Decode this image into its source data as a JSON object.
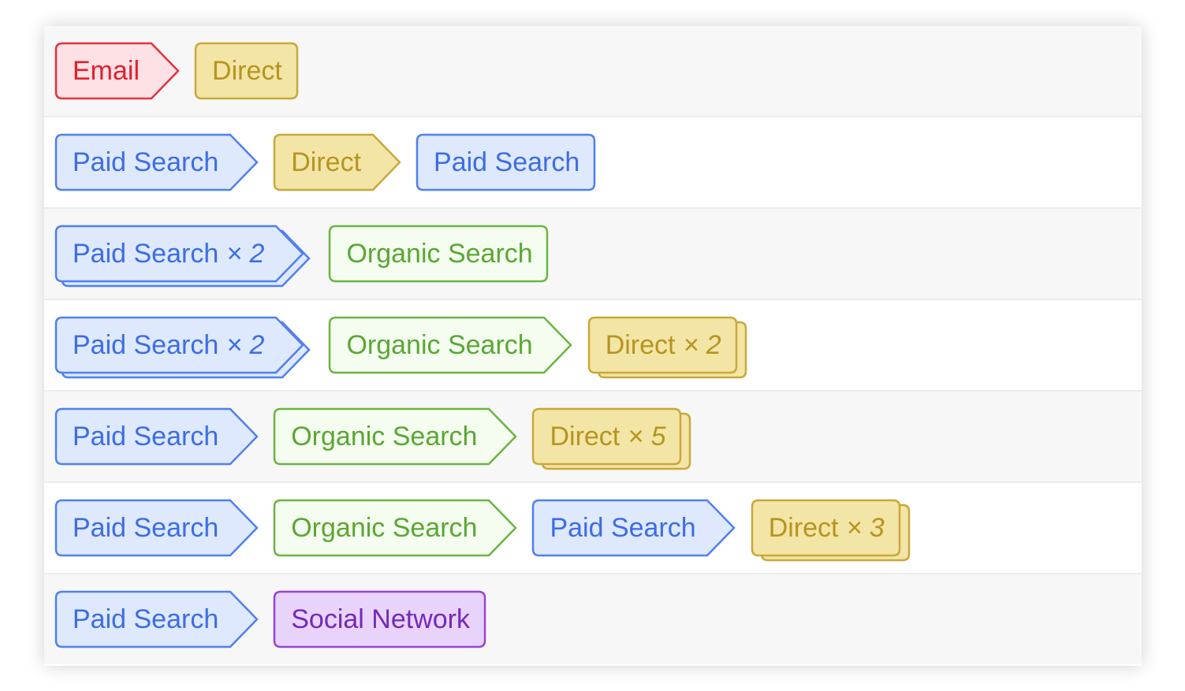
{
  "channels": {
    "email": {
      "stroke": "#e4323d",
      "fill": "#fde1e4",
      "text": "#e1202e"
    },
    "direct": {
      "stroke": "#c9a83a",
      "fill": "#f3e5a5",
      "text": "#b5951f"
    },
    "paid": {
      "stroke": "#4f80f0",
      "fill": "#dfe9fd",
      "text": "#3c6de6"
    },
    "organic": {
      "stroke": "#6bb442",
      "fill": "#f4fdef",
      "text": "#5aa733"
    },
    "social": {
      "stroke": "#9b42d6",
      "fill": "#e8d4fb",
      "text": "#7428bc"
    }
  },
  "rows": [
    {
      "steps": [
        {
          "label": "Email",
          "channel": "email"
        },
        {
          "label": "Direct",
          "channel": "direct"
        }
      ]
    },
    {
      "steps": [
        {
          "label": "Paid Search",
          "channel": "paid"
        },
        {
          "label": "Direct",
          "channel": "direct"
        },
        {
          "label": "Paid Search",
          "channel": "paid"
        }
      ]
    },
    {
      "steps": [
        {
          "label": "Paid Search",
          "channel": "paid",
          "count": "× 2"
        },
        {
          "label": "Organic Search",
          "channel": "organic"
        }
      ]
    },
    {
      "steps": [
        {
          "label": "Paid Search",
          "channel": "paid",
          "count": "× 2"
        },
        {
          "label": "Organic Search",
          "channel": "organic"
        },
        {
          "label": "Direct",
          "channel": "direct",
          "count": "× 2"
        }
      ]
    },
    {
      "steps": [
        {
          "label": "Paid Search",
          "channel": "paid"
        },
        {
          "label": "Organic Search",
          "channel": "organic"
        },
        {
          "label": "Direct",
          "channel": "direct",
          "count": "× 5"
        }
      ]
    },
    {
      "steps": [
        {
          "label": "Paid Search",
          "channel": "paid"
        },
        {
          "label": "Organic Search",
          "channel": "organic"
        },
        {
          "label": "Paid Search",
          "channel": "paid"
        },
        {
          "label": "Direct",
          "channel": "direct",
          "count": "× 3"
        }
      ]
    },
    {
      "steps": [
        {
          "label": "Paid Search",
          "channel": "paid"
        },
        {
          "label": "Social Network",
          "channel": "social"
        }
      ]
    }
  ]
}
